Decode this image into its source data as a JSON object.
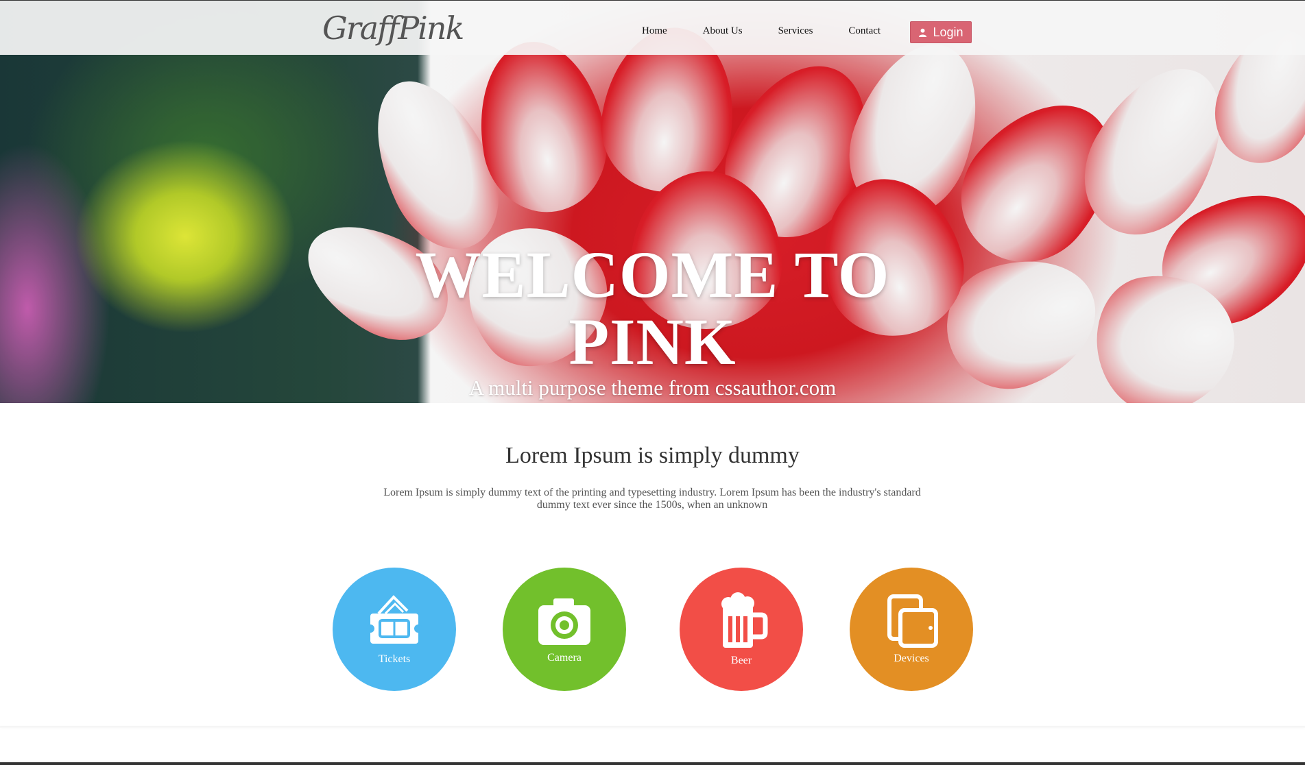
{
  "header": {
    "logo_text": "GraffPink",
    "nav": [
      "Home",
      "About Us",
      "Services",
      "Contact"
    ],
    "login_label": "Login"
  },
  "hero": {
    "title_line1": "WELCOME TO",
    "title_line2": "PINK",
    "subtitle": "A multi purpose theme from cssauthor.com"
  },
  "intro": {
    "heading": "Lorem Ipsum is simply dummy",
    "body": "Lorem Ipsum is simply dummy text of the printing and typesetting industry. Lorem Ipsum has been the industry's standard dummy text ever since the 1500s, when an unknown"
  },
  "features": [
    {
      "label": "Tickets",
      "icon": "tickets-icon",
      "color": "#4db8f0"
    },
    {
      "label": "Camera",
      "icon": "camera-icon",
      "color": "#72c02c"
    },
    {
      "label": "Beer",
      "icon": "beer-icon",
      "color": "#f24e47"
    },
    {
      "label": "Devices",
      "icon": "devices-icon",
      "color": "#e38f24"
    }
  ]
}
